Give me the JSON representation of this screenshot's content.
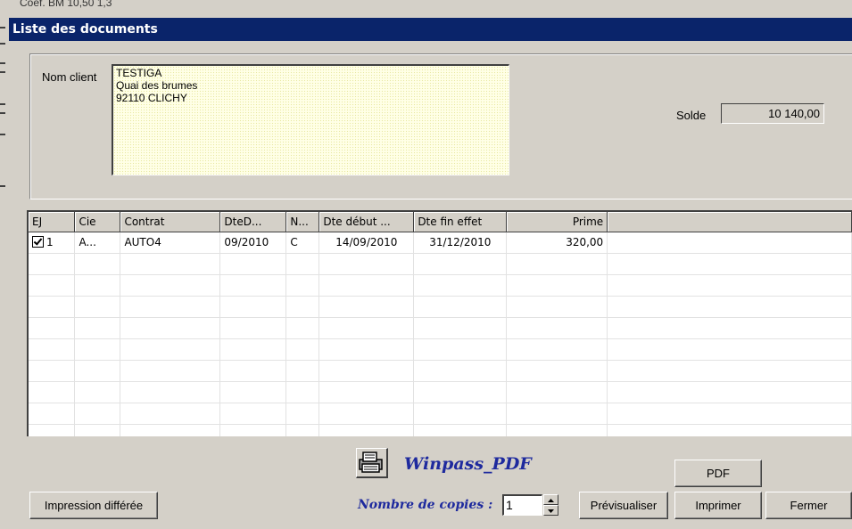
{
  "background_fragment": "Coef. BM   10,50       1,3",
  "window": {
    "title": "Liste des documents"
  },
  "client": {
    "label": "Nom client",
    "lines": [
      "TESTIGA",
      "Quai des brumes",
      "92110 CLICHY"
    ]
  },
  "solde": {
    "label": "Solde",
    "value": "10 140,00"
  },
  "table": {
    "columns": [
      "EJ",
      "Cie",
      "Contrat",
      "DteD...",
      "N...",
      "Dte début ...",
      "Dte fin effet",
      "Prime",
      ""
    ],
    "rows": [
      {
        "ej": "1",
        "checked": true,
        "cie": "A...",
        "contrat": "AUTO4",
        "dted": "09/2010",
        "n": "C",
        "debut": "14/09/2010",
        "fin": "31/12/2010",
        "prime": "320,00"
      }
    ]
  },
  "buttons": {
    "impression_differee": "Impression différée",
    "pdf": "PDF",
    "previsualiser": "Prévisualiser",
    "imprimer": "Imprimer",
    "fermer": "Fermer"
  },
  "printer": {
    "name": "Winpass_PDF",
    "icon": "printer-icon"
  },
  "copies": {
    "label": "Nombre de copies :",
    "value": "1"
  },
  "colors": {
    "titlebar": "#0a246a",
    "accent_text": "#1e2a9e",
    "face": "#d4d0c8",
    "client_box": "#ffffe6"
  }
}
